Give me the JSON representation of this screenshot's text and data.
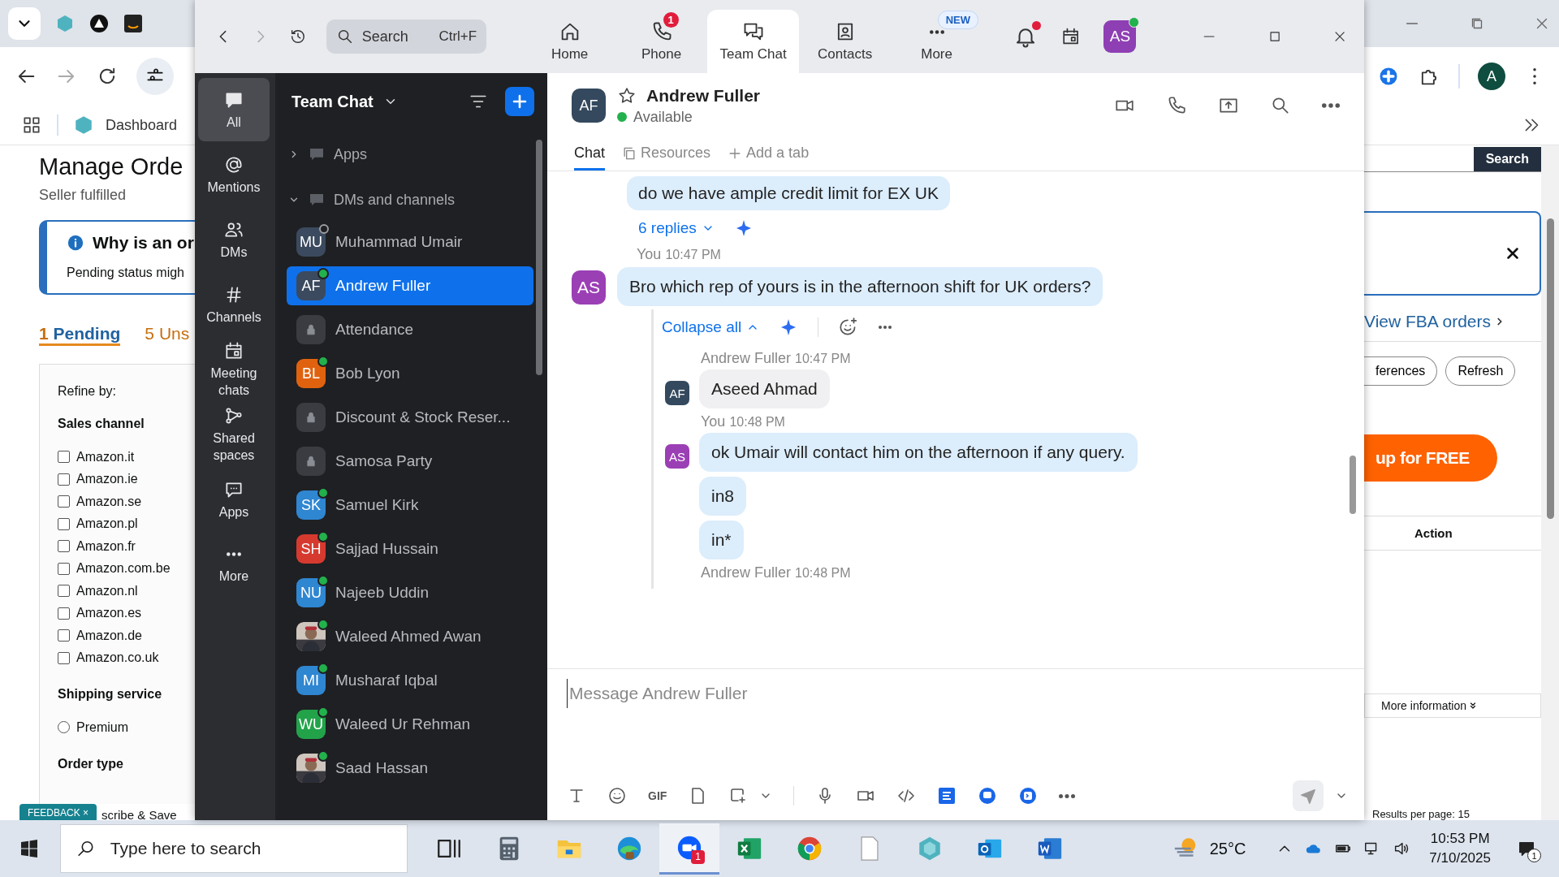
{
  "browser": {
    "bookmark": "Dashboard",
    "profile_initial": "A",
    "page_left": {
      "title": "Manage Orde",
      "subtitle": "Seller fulfilled",
      "notice_title": "Why is an or",
      "notice_text": "Pending status migh",
      "tabs": [
        {
          "count": "1",
          "label": "Pending",
          "selected": true
        },
        {
          "count": "5",
          "label": "Uns",
          "selected": false
        }
      ],
      "refine_label": "Refine by:",
      "sections": [
        {
          "title": "Sales channel",
          "options": [
            {
              "kind": "checkbox",
              "label": "Amazon.it",
              "checked": false
            },
            {
              "kind": "checkbox",
              "label": "Amazon.ie",
              "checked": false
            },
            {
              "kind": "checkbox",
              "label": "Amazon.se",
              "checked": false
            },
            {
              "kind": "checkbox",
              "label": "Amazon.pl",
              "checked": false
            },
            {
              "kind": "checkbox",
              "label": "Amazon.fr",
              "checked": false
            },
            {
              "kind": "checkbox",
              "label": "Amazon.com.be",
              "checked": false
            },
            {
              "kind": "checkbox",
              "label": "Amazon.nl",
              "checked": false
            },
            {
              "kind": "checkbox",
              "label": "Amazon.es",
              "checked": false
            },
            {
              "kind": "checkbox",
              "label": "Amazon.de",
              "checked": false
            },
            {
              "kind": "checkbox",
              "label": "Amazon.co.uk",
              "checked": false
            }
          ]
        },
        {
          "title": "Shipping service",
          "options": [
            {
              "kind": "radio",
              "label": "Premium",
              "checked": false
            }
          ]
        },
        {
          "title": "Order type"
        }
      ],
      "feedback": {
        "label": "FEEDBACK",
        "close": "×"
      },
      "footer_text": "scribe & Save"
    },
    "page_right": {
      "search_button": "Search",
      "fba_link": "View FBA orders",
      "buttons": [
        "ferences",
        "Refresh"
      ],
      "promo": "up for FREE",
      "column_header": "Action",
      "more_info": "More information",
      "results": "Results per page: 15"
    }
  },
  "zoom": {
    "search": {
      "placeholder": "Search",
      "shortcut": "Ctrl+F"
    },
    "tabs": [
      {
        "label": "Home",
        "selected": false
      },
      {
        "label": "Phone",
        "selected": false,
        "badge": {
          "kind": "count",
          "text": "1"
        }
      },
      {
        "label": "Team Chat",
        "selected": true
      },
      {
        "label": "Contacts",
        "selected": false
      },
      {
        "label": "More",
        "selected": false,
        "badge": {
          "kind": "new",
          "text": "NEW"
        }
      }
    ],
    "notifications": {
      "unread": true
    },
    "profile": {
      "initials": "AS",
      "online": true
    },
    "nav": [
      {
        "label": "All",
        "selected": true
      },
      {
        "label": "Mentions",
        "selected": false
      },
      {
        "label": "DMs",
        "selected": false
      },
      {
        "label": "Channels",
        "selected": false
      },
      {
        "label": "Meeting chats",
        "selected": false
      },
      {
        "label": "Shared spaces",
        "selected": false
      },
      {
        "label": "Apps",
        "selected": false
      },
      {
        "label": "More",
        "selected": false
      }
    ],
    "sidebar": {
      "title": "Team Chat",
      "sections": [
        {
          "label": "Apps",
          "expanded": false
        },
        {
          "label": "DMs and channels",
          "expanded": true,
          "children": [
            {
              "kind": "person",
              "initials": "MU",
              "name": "Muhammad Umair",
              "color": "#3b4a5e",
              "online": false,
              "selected": false
            },
            {
              "kind": "person",
              "initials": "AF",
              "name": "Andrew Fuller",
              "color": "#3b4a5e",
              "online": true,
              "selected": true
            },
            {
              "kind": "channel",
              "name": "Attendance",
              "selected": false
            },
            {
              "kind": "person",
              "initials": "BL",
              "name": "Bob Lyon",
              "color": "#e0620f",
              "online": true,
              "selected": false
            },
            {
              "kind": "channel",
              "name": "Discount & Stock Reser...",
              "selected": false
            },
            {
              "kind": "channel",
              "name": "Samosa Party",
              "selected": false
            },
            {
              "kind": "person",
              "initials": "SK",
              "name": "Samuel Kirk",
              "color": "#2f86d1",
              "online": true,
              "selected": false
            },
            {
              "kind": "person",
              "initials": "SH",
              "name": "Sajjad Hussain",
              "color": "#d63a2f",
              "online": true,
              "selected": false
            },
            {
              "kind": "person",
              "initials": "NU",
              "name": "Najeeb Uddin",
              "color": "#2f86d1",
              "online": true,
              "selected": false
            },
            {
              "name": "Waleed Ahmed Awan",
              "online": true,
              "selected": false
            },
            {
              "kind": "person",
              "initials": "MI",
              "name": "Musharaf Iqbal",
              "color": "#2f86d1",
              "online": true,
              "selected": false
            },
            {
              "kind": "person",
              "initials": "WU",
              "name": "Waleed Ur Rehman",
              "color": "#22a34a",
              "online": true,
              "selected": false
            },
            {
              "name": "Saad Hassan",
              "online": true,
              "selected": false
            }
          ]
        }
      ]
    },
    "chat": {
      "initials": "AF",
      "name": "Andrew Fuller",
      "status": "Available",
      "starred": false,
      "tabs": [
        {
          "label": "Chat",
          "selected": true
        },
        {
          "label": "Resources",
          "selected": false
        }
      ],
      "add_tab": "Add a tab",
      "top_message": {
        "text": "do we have ample credit limit for EX UK",
        "replies": "6 replies"
      },
      "message": {
        "sender": "You",
        "time": "10:47 PM",
        "initials": "AS",
        "text": "Bro which rep of yours is in the afternoon shift for UK orders?",
        "collapse": "Collapse all"
      },
      "thread": [
        {
          "sender": "Andrew Fuller",
          "time": "10:47 PM",
          "initials": "AF",
          "mine": false,
          "bubbles": [
            "Aseed Ahmad"
          ]
        },
        {
          "sender": "You",
          "time": "10:48 PM",
          "initials": "AS",
          "mine": true,
          "bubbles": [
            "ok Umair will contact him on the afternoon if any query.",
            "in8",
            "in*"
          ]
        },
        {
          "sender": "Andrew Fuller",
          "time": "10:48 PM"
        }
      ],
      "composer": {
        "placeholder": "Message Andrew Fuller",
        "gif": "GIF"
      }
    }
  },
  "taskbar": {
    "search_placeholder": "Type here to search",
    "zoom_badge": "1",
    "weather": "25°C",
    "time": "10:53 PM",
    "date": "7/10/2025",
    "notifications": "1"
  }
}
